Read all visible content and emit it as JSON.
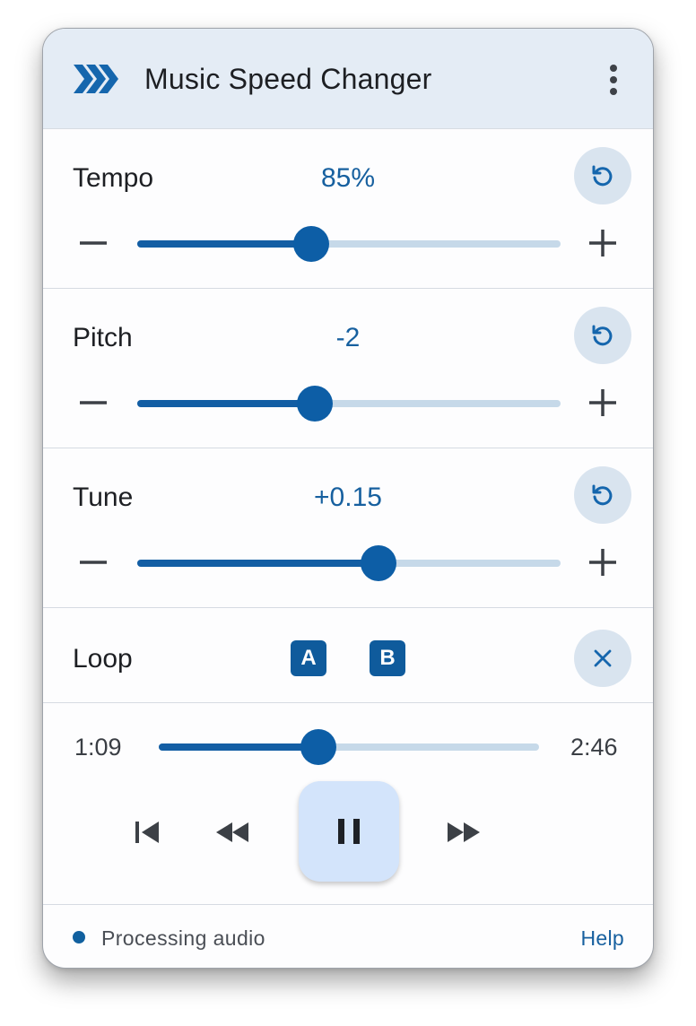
{
  "app": {
    "title": "Music Speed Changer",
    "icon": "fast-forward-chevrons-icon",
    "accent": "#0f5b9c"
  },
  "tempo": {
    "label": "Tempo",
    "value": "85%",
    "level": 0.41
  },
  "pitch": {
    "label": "Pitch",
    "value": "-2",
    "level": 0.42
  },
  "tune": {
    "label": "Tune",
    "value": "+0.15",
    "level": 0.57
  },
  "loop": {
    "label": "Loop",
    "a_label": "A",
    "b_label": "B"
  },
  "player": {
    "current_time": "1:09",
    "total_time": "2:46",
    "progress": 0.42
  },
  "footer": {
    "status": "Processing audio",
    "help": "Help"
  }
}
